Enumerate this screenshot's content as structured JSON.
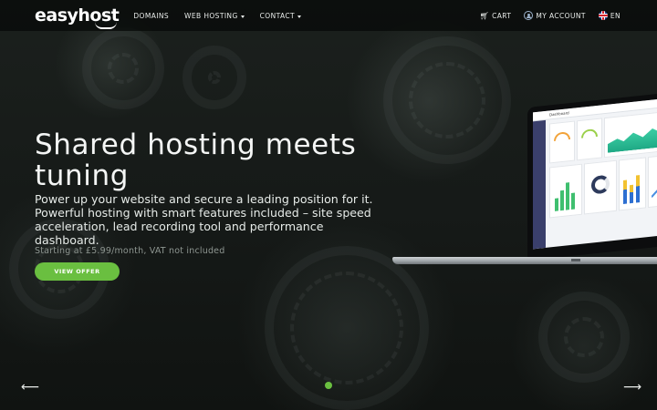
{
  "brand": {
    "logo_text": "easyhost"
  },
  "nav": {
    "items": [
      {
        "label": "DOMAINS",
        "has_dropdown": false
      },
      {
        "label": "WEB HOSTING",
        "has_dropdown": true
      },
      {
        "label": "CONTACT",
        "has_dropdown": true
      }
    ],
    "right": {
      "cart_label": "CART",
      "account_label": "MY ACCOUNT",
      "language_label": "EN"
    }
  },
  "hero": {
    "title": "Shared hosting meets tuning",
    "description": "Power up your website and secure a leading position for it. Powerful hosting with smart features included – site speed acceleration, lead recording tool and performance dashboard.",
    "price_note": "Starting at £5.99/month, VAT not included",
    "cta_label": "VIEW OFFER"
  },
  "laptop_screen": {
    "dashboard_title": "Dashboard"
  },
  "carousel": {
    "prev_icon": "arrow-left-icon",
    "next_icon": "arrow-right-icon",
    "slides": 1,
    "active_index": 0
  },
  "colors": {
    "accent": "#6abf40",
    "nav_bg": "#080a09",
    "text": "#ffffff",
    "muted": "#8e9691"
  }
}
